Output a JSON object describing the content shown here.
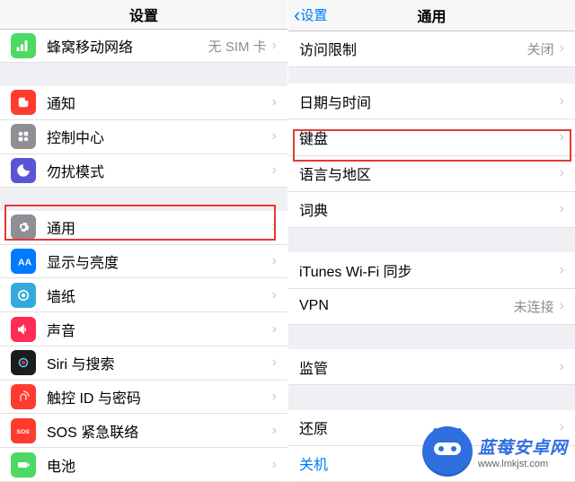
{
  "left": {
    "title": "设置",
    "groups": [
      [
        {
          "icon": "cellular",
          "label": "蜂窝移动网络",
          "value": "无 SIM 卡"
        }
      ],
      [
        {
          "icon": "notifications",
          "label": "通知"
        },
        {
          "icon": "control-center",
          "label": "控制中心"
        },
        {
          "icon": "dnd",
          "label": "勿扰模式"
        }
      ],
      [
        {
          "icon": "general",
          "label": "通用"
        },
        {
          "icon": "display",
          "label": "显示与亮度"
        },
        {
          "icon": "wallpaper",
          "label": "墙纸"
        },
        {
          "icon": "sound",
          "label": "声音"
        },
        {
          "icon": "siri",
          "label": "Siri 与搜索"
        },
        {
          "icon": "touchid",
          "label": "触控 ID 与密码"
        },
        {
          "icon": "sos",
          "label": "SOS 紧急联络"
        },
        {
          "icon": "battery",
          "label": "电池"
        }
      ]
    ]
  },
  "right": {
    "back": "设置",
    "title": "通用",
    "groups": [
      [
        {
          "label": "访问限制",
          "value": "关闭"
        }
      ],
      [
        {
          "label": "日期与时间"
        },
        {
          "label": "键盘"
        },
        {
          "label": "语言与地区"
        },
        {
          "label": "词典"
        }
      ],
      [
        {
          "label": "iTunes Wi-Fi 同步"
        },
        {
          "label": "VPN",
          "value": "未连接"
        }
      ],
      [
        {
          "label": "监管"
        }
      ],
      [
        {
          "label": "还原"
        },
        {
          "label": "关机",
          "link": true,
          "no_arrow": true
        }
      ]
    ]
  },
  "watermark": {
    "title": "蓝莓安卓网",
    "url": "www.lmkjst.com"
  }
}
